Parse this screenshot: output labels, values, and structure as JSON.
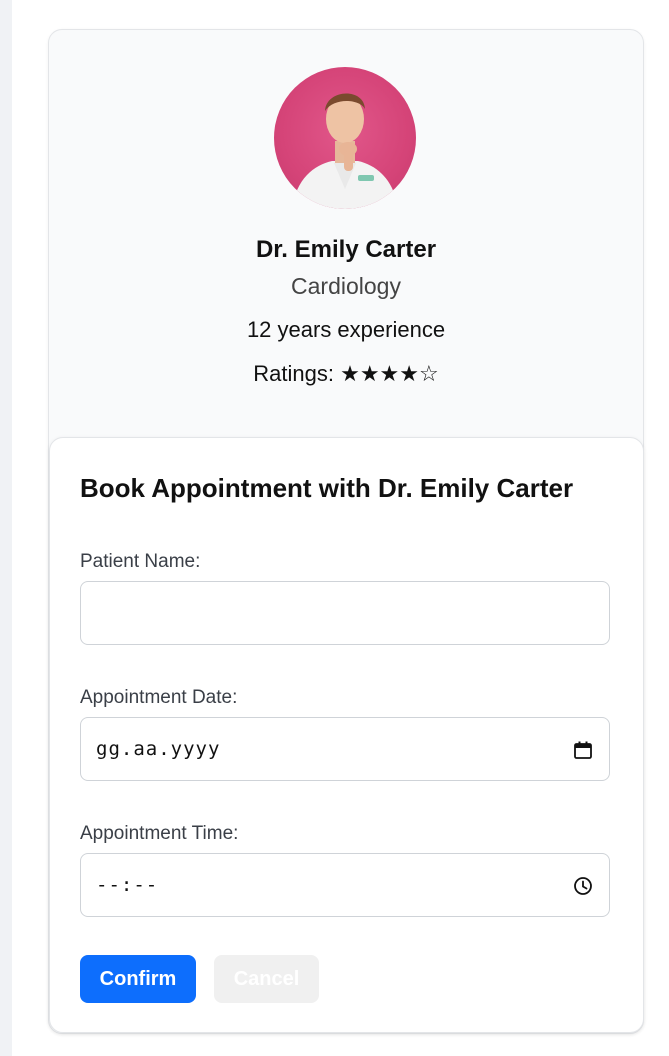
{
  "doctor": {
    "name": "Dr. Emily Carter",
    "specialty": "Cardiology",
    "experience": "12 years experience",
    "ratings_label": "Ratings:",
    "ratings_stars": "★★★★☆",
    "rating_value": 4,
    "rating_max": 5,
    "avatar_icon": "doctor-portrait"
  },
  "booking": {
    "title": "Book Appointment with Dr. Emily Carter",
    "patient_name_label": "Patient Name:",
    "patient_name_value": "",
    "date_label": "Appointment Date:",
    "date_placeholder": "gg.aa.yyyy",
    "date_icon": "calendar-icon",
    "time_label": "Appointment Time:",
    "time_placeholder": "--:--",
    "time_icon": "clock-icon",
    "confirm_label": "Confirm",
    "cancel_label": "Cancel"
  },
  "colors": {
    "primary": "#0d6efd",
    "avatar_bg": "#d54478",
    "cancel_bg": "#f0f0f0"
  }
}
